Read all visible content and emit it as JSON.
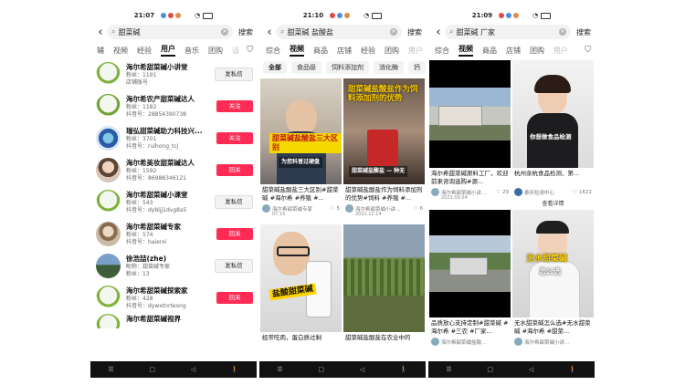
{
  "phones": [
    {
      "status": {
        "time": "21:07"
      },
      "search": {
        "query": "甜菜碱",
        "button": "搜索"
      },
      "tabs": [
        "辅",
        "视频",
        "经验",
        "用户",
        "音乐",
        "团购",
        "话"
      ],
      "users": [
        {
          "name": "海尔希甜菜碱小讲堂",
          "line1": "粉丝：1191",
          "line2": "店铺账号",
          "action": "发私信",
          "style": "gray"
        },
        {
          "name": "海尔希农产甜菜碱达人",
          "line1": "粉丝：1182",
          "line2": "抖音号：28854390738",
          "action": "关注",
          "style": "red"
        },
        {
          "name": "瑞弘甜菜碱助力科技兴...",
          "line1": "粉丝：3701",
          "line2": "抖音号：ruihong_tcj",
          "action": "关注",
          "style": "red"
        },
        {
          "name": "海尔希美妆甜菜碱达人",
          "line1": "粉丝：1592",
          "line2": "抖音号：86988346121",
          "action": "回关",
          "style": "red"
        },
        {
          "name": "海尔希甜菜碱小课堂",
          "line1": "粉丝：543",
          "line2": "抖音号：dybljj1dvg8a5",
          "action": "发私信",
          "style": "gray"
        },
        {
          "name": "海尔希甜菜碱专家",
          "line1": "粉丝：574",
          "line2": "抖音号：haierxi",
          "action": "回关",
          "style": "red"
        },
        {
          "name": "徐浩喆(zhe)",
          "line1": "昵称：甜菜碱专家",
          "line2": "粉丝：13",
          "action": "发私信",
          "style": "gray"
        },
        {
          "name": "海尔希甜菜碱探索家",
          "line1": "粉丝：428",
          "line2": "抖音号：dywxtnrteong",
          "action": "回关",
          "style": "red"
        },
        {
          "name": "海尔希甜菜碱视界",
          "line1": "",
          "line2": "",
          "action": "",
          "style": "none"
        }
      ],
      "nav": [
        "☰",
        "□",
        "◁",
        "🚶"
      ]
    },
    {
      "status": {
        "time": "21:10"
      },
      "search": {
        "query": "甜菜碱 盐酸盐",
        "button": "搜索"
      },
      "tabs": [
        "综合",
        "视频",
        "商品",
        "店铺",
        "经验",
        "团购",
        "用户"
      ],
      "chips": [
        "全部",
        "食品级",
        "饲料添加剂",
        "消化酶",
        "钙"
      ],
      "cards": [
        {
          "overlay": "甜菜碱盐酸盐三大区别",
          "overlay2": "为您科普过硬盘",
          "title": "甜菜碱盐酸盐三大区别#甜菜碱 #海尔希 #养殖 #...",
          "author": "海尔希甜菜碱专家",
          "likes": "5",
          "date": "07.15"
        },
        {
          "overlay": "甜菜碱盐酸盐作为饲料添加剂的优势",
          "overlay2": "甜菜碱盐酸盐 — 种无",
          "title": "甜菜碱盐酸盐作为饲料添加剂的优势#饲料 #养殖 #...",
          "author": "海尔希甜菜碱小讲...",
          "likes": "6",
          "date": "2022.12.14"
        },
        {
          "overlay": "盐酸甜菜碱",
          "overlay2": "",
          "title": "经常吃肉，蛋白质过剩",
          "author": "",
          "likes": "",
          "date": ""
        },
        {
          "overlay": "",
          "overlay2": "",
          "title": "甜菜碱盐酸盐在农业中的",
          "author": "",
          "likes": "",
          "date": ""
        }
      ],
      "nav": [
        "☰",
        "□",
        "◁",
        "🚶"
      ]
    },
    {
      "status": {
        "time": "21:09"
      },
      "search": {
        "query": "甜菜碱 厂家",
        "button": "搜索"
      },
      "tabs": [
        "综合",
        "视频",
        "商品",
        "店铺",
        "团购",
        "用户"
      ],
      "cards": [
        {
          "overlay": "",
          "overlay2": "",
          "title": "海尔希甜菜碱原料工厂，欢迎前来咨询选购#源...",
          "author": "海尔希甜菜碱小讲...",
          "likes": "29",
          "date": "2023.09.04",
          "owner": ""
        },
        {
          "overlay": "你想做食品检测",
          "overlay2": "",
          "title": "杭州余杭食品检测、第...",
          "author": "泰庆检测中心",
          "likes": "1622",
          "date": "",
          "owner": "查看详情"
        },
        {
          "overlay": "",
          "overlay2": "",
          "title": "品质放心支持定制#甜菜碱 #海尔希 #三农 #厂家...",
          "author": "海尔希甜菜碱盐酸...",
          "likes": "",
          "date": "",
          "owner": ""
        },
        {
          "overlay": "无水甜菜碱",
          "overlay2": "怎么选",
          "title": "无水甜菜碱怎么选#无水甜菜碱 #海尔希 #甜菜...",
          "author": "海尔希甜菜碱小讲...",
          "likes": "",
          "date": "",
          "owner": ""
        }
      ],
      "nav": [
        "☰",
        "□",
        "◁",
        "🚶"
      ]
    }
  ],
  "colors": {
    "accent": "#fe2c55",
    "nav": "#111111"
  }
}
